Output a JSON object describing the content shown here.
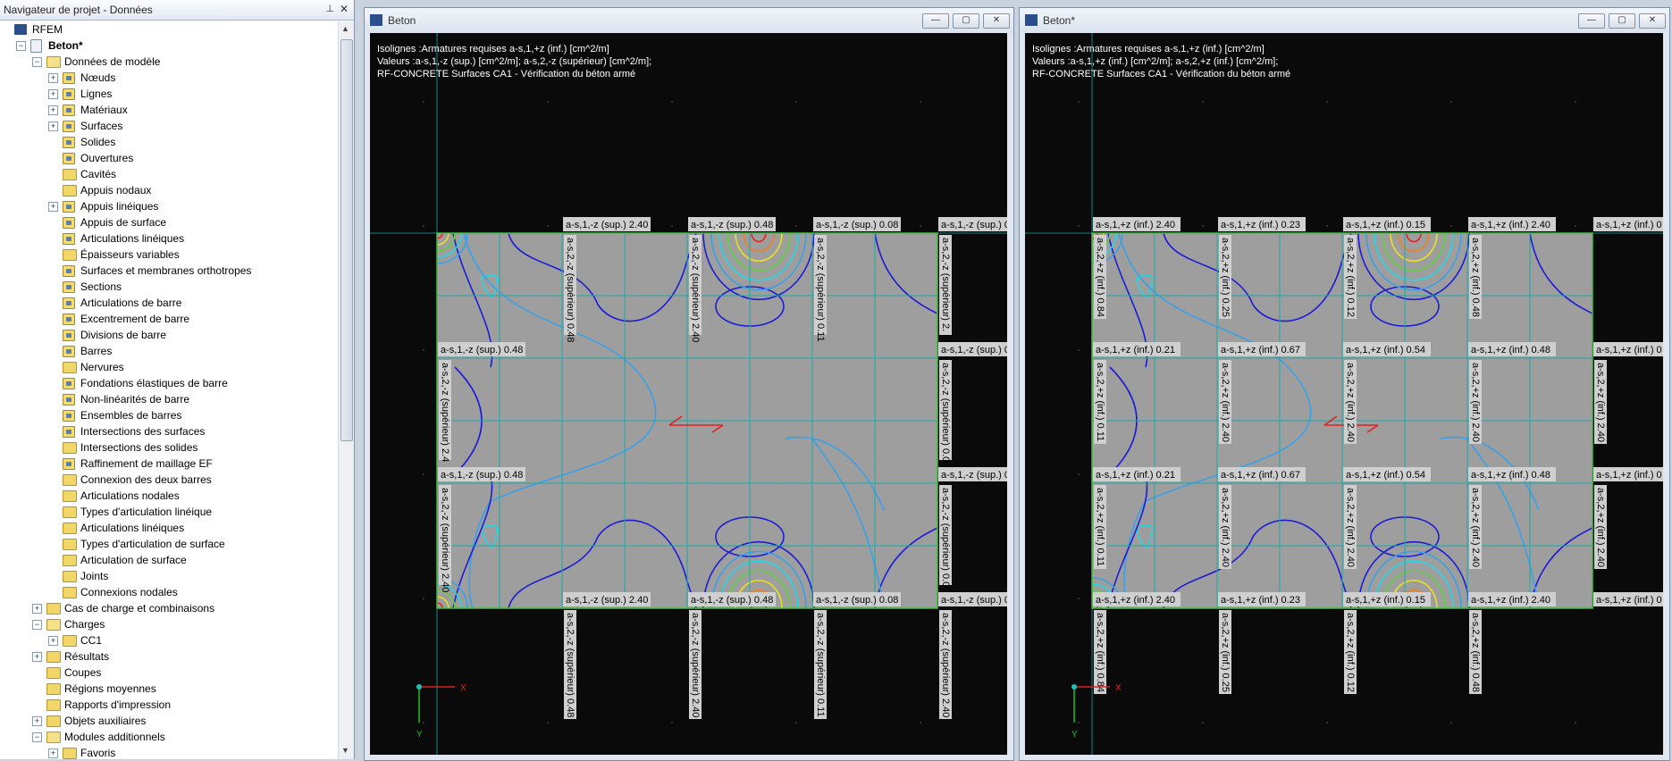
{
  "navigator": {
    "title": "Navigateur de projet - Données",
    "tree": [
      {
        "label": "RFEM",
        "level": 0,
        "exp": "",
        "icon": "app",
        "bold": false,
        "name": "tree-item-rfem"
      },
      {
        "label": "Beton*",
        "level": 1,
        "exp": "-",
        "icon": "doc",
        "bold": true,
        "name": "tree-item-beton"
      },
      {
        "label": "Données de modèle",
        "level": 2,
        "exp": "-",
        "icon": "folder open",
        "bold": false,
        "name": "tree-item-donnees-modele"
      },
      {
        "label": "Nœuds",
        "level": 3,
        "exp": "+",
        "icon": "item",
        "bold": false,
        "name": "tree-item-noeuds"
      },
      {
        "label": "Lignes",
        "level": 3,
        "exp": "+",
        "icon": "item",
        "bold": false,
        "name": "tree-item-lignes"
      },
      {
        "label": "Matériaux",
        "level": 3,
        "exp": "+",
        "icon": "item",
        "bold": false,
        "name": "tree-item-materiaux"
      },
      {
        "label": "Surfaces",
        "level": 3,
        "exp": "+",
        "icon": "item",
        "bold": false,
        "name": "tree-item-surfaces"
      },
      {
        "label": "Solides",
        "level": 3,
        "exp": "",
        "icon": "item",
        "bold": false,
        "name": "tree-item-solides"
      },
      {
        "label": "Ouvertures",
        "level": 3,
        "exp": "",
        "icon": "item",
        "bold": false,
        "name": "tree-item-ouvertures"
      },
      {
        "label": "Cavités",
        "level": 3,
        "exp": "",
        "icon": "folder",
        "bold": false,
        "name": "tree-item-cavites"
      },
      {
        "label": "Appuis nodaux",
        "level": 3,
        "exp": "",
        "icon": "folder",
        "bold": false,
        "name": "tree-item-appuis-nodaux"
      },
      {
        "label": "Appuis linéiques",
        "level": 3,
        "exp": "+",
        "icon": "item",
        "bold": false,
        "name": "tree-item-appuis-lineiques"
      },
      {
        "label": "Appuis de surface",
        "level": 3,
        "exp": "",
        "icon": "item",
        "bold": false,
        "name": "tree-item-appuis-surface"
      },
      {
        "label": "Articulations linéiques",
        "level": 3,
        "exp": "",
        "icon": "item",
        "bold": false,
        "name": "tree-item-articulations-lineiques"
      },
      {
        "label": "Épaisseurs variables",
        "level": 3,
        "exp": "",
        "icon": "folder",
        "bold": false,
        "name": "tree-item-epaisseurs-variables"
      },
      {
        "label": "Surfaces et membranes orthotropes",
        "level": 3,
        "exp": "",
        "icon": "item",
        "bold": false,
        "name": "tree-item-surfaces-orthotropes"
      },
      {
        "label": "Sections",
        "level": 3,
        "exp": "",
        "icon": "item",
        "bold": false,
        "name": "tree-item-sections"
      },
      {
        "label": "Articulations de barre",
        "level": 3,
        "exp": "",
        "icon": "item",
        "bold": false,
        "name": "tree-item-articulations-barre"
      },
      {
        "label": "Excentrement de barre",
        "level": 3,
        "exp": "",
        "icon": "item",
        "bold": false,
        "name": "tree-item-excentrement-barre"
      },
      {
        "label": "Divisions de barre",
        "level": 3,
        "exp": "",
        "icon": "item",
        "bold": false,
        "name": "tree-item-divisions-barre"
      },
      {
        "label": "Barres",
        "level": 3,
        "exp": "",
        "icon": "item",
        "bold": false,
        "name": "tree-item-barres"
      },
      {
        "label": "Nervures",
        "level": 3,
        "exp": "",
        "icon": "folder",
        "bold": false,
        "name": "tree-item-nervures"
      },
      {
        "label": "Fondations élastiques de barre",
        "level": 3,
        "exp": "",
        "icon": "item",
        "bold": false,
        "name": "tree-item-fondations-elastiques"
      },
      {
        "label": "Non-linéarités de barre",
        "level": 3,
        "exp": "",
        "icon": "item",
        "bold": false,
        "name": "tree-item-non-linearites"
      },
      {
        "label": "Ensembles de barres",
        "level": 3,
        "exp": "",
        "icon": "item",
        "bold": false,
        "name": "tree-item-ensembles-barres"
      },
      {
        "label": "Intersections des surfaces",
        "level": 3,
        "exp": "",
        "icon": "item",
        "bold": false,
        "name": "tree-item-intersections-surfaces"
      },
      {
        "label": "Intersections des solides",
        "level": 3,
        "exp": "",
        "icon": "folder",
        "bold": false,
        "name": "tree-item-intersections-solides"
      },
      {
        "label": "Raffinement de maillage EF",
        "level": 3,
        "exp": "",
        "icon": "item",
        "bold": false,
        "name": "tree-item-raffinement-maillage"
      },
      {
        "label": "Connexion des deux barres",
        "level": 3,
        "exp": "",
        "icon": "folder",
        "bold": false,
        "name": "tree-item-connexion-barres"
      },
      {
        "label": "Articulations nodales",
        "level": 3,
        "exp": "",
        "icon": "folder",
        "bold": false,
        "name": "tree-item-articulations-nodales"
      },
      {
        "label": "Types d'articulation linéique",
        "level": 3,
        "exp": "",
        "icon": "folder",
        "bold": false,
        "name": "tree-item-types-articulation-lineique"
      },
      {
        "label": "Articulations linéiques",
        "level": 3,
        "exp": "",
        "icon": "folder",
        "bold": false,
        "name": "tree-item-articulations-lineiques-2"
      },
      {
        "label": "Types d'articulation de surface",
        "level": 3,
        "exp": "",
        "icon": "folder",
        "bold": false,
        "name": "tree-item-types-articulation-surface"
      },
      {
        "label": "Articulation de surface",
        "level": 3,
        "exp": "",
        "icon": "folder",
        "bold": false,
        "name": "tree-item-articulation-surface"
      },
      {
        "label": "Joints",
        "level": 3,
        "exp": "",
        "icon": "folder",
        "bold": false,
        "name": "tree-item-joints"
      },
      {
        "label": "Connexions nodales",
        "level": 3,
        "exp": "",
        "icon": "folder",
        "bold": false,
        "name": "tree-item-connexions-nodales"
      },
      {
        "label": "Cas de charge et combinaisons",
        "level": 2,
        "exp": "+",
        "icon": "folder",
        "bold": false,
        "name": "tree-item-cas-charge"
      },
      {
        "label": "Charges",
        "level": 2,
        "exp": "-",
        "icon": "folder open",
        "bold": false,
        "name": "tree-item-charges"
      },
      {
        "label": "CC1",
        "level": 3,
        "exp": "+",
        "icon": "folder",
        "bold": false,
        "name": "tree-item-cc1"
      },
      {
        "label": "Résultats",
        "level": 2,
        "exp": "+",
        "icon": "folder",
        "bold": false,
        "name": "tree-item-resultats"
      },
      {
        "label": "Coupes",
        "level": 2,
        "exp": "",
        "icon": "folder",
        "bold": false,
        "name": "tree-item-coupes"
      },
      {
        "label": "Régions moyennes",
        "level": 2,
        "exp": "",
        "icon": "folder",
        "bold": false,
        "name": "tree-item-regions-moyennes"
      },
      {
        "label": "Rapports d'impression",
        "level": 2,
        "exp": "",
        "icon": "folder",
        "bold": false,
        "name": "tree-item-rapports"
      },
      {
        "label": "Objets auxiliaires",
        "level": 2,
        "exp": "+",
        "icon": "folder",
        "bold": false,
        "name": "tree-item-objets-auxiliaires"
      },
      {
        "label": "Modules additionnels",
        "level": 2,
        "exp": "-",
        "icon": "folder open",
        "bold": false,
        "name": "tree-item-modules-additionnels"
      },
      {
        "label": "Favoris",
        "level": 3,
        "exp": "+",
        "icon": "folder",
        "bold": false,
        "name": "tree-item-favoris"
      }
    ]
  },
  "windows": [
    {
      "title": "Beton",
      "info": [
        "Isolignes :Armatures requises a-s,1,+z (inf.) [cm^2/m]",
        "Valeurs :a-s,1,-z (sup.) [cm^2/m]; a-s,2,-z (supérieur) [cm^2/m];",
        "RF-CONCRETE Surfaces CA1 - Vérification du béton armé"
      ],
      "labels": {
        "top": [
          "a-s,1,-z (sup.)  2.40",
          "a-s,1,-z (sup.)  0.48",
          "a-s,1,-z (sup.)  0.08",
          "a-s,1,-z (sup.)  0",
          "a-s,1,-z (sup.)  0.48",
          "a-s,1,-z (sup.)  0.",
          "a-s,1,-z (sup.)  0.48",
          "a-s,1,-z (sup.)  0.",
          "a-s,1,-z (sup.)  2.40",
          "a-s,1,-z (sup.)  0.48",
          "a-s,1,-z (sup.)  0.08",
          "a-s,1,-z (sup.)  0"
        ],
        "side": [
          "a-s,2,-z (supérieur)  0.48",
          "a-s,2,-z (supérieur)  2.40",
          "a-s,2,-z (supérieur)  0.11",
          "a-s,2,-z (supérieur)  2.",
          "a-s,2,-z (supérieur)  2.4",
          "a-s,2,-z (supérieur)  0.0",
          "a-s,2,-z (supérieur)  2.40",
          "a-s,2,-z (supérieur)  0.0",
          "a-s,2,-z (supérieur)  0.48",
          "a-s,2,-z (supérieur)  2.40",
          "a-s,2,-z (supérieur)  0.11",
          "a-s,2,-z (supérieur)  2.40"
        ]
      }
    },
    {
      "title": "Beton*",
      "info": [
        "Isolignes :Armatures requises a-s,1,+z (inf.) [cm^2/m]",
        "Valeurs :a-s,1,+z (inf.) [cm^2/m]; a-s,2,+z (inf.) [cm^2/m];",
        "RF-CONCRETE Surfaces CA1 - Vérification du béton armé"
      ],
      "labels": {
        "top": [
          "a-s,1,+z (inf.)  2.40",
          "a-s,1,+z (inf.)  0.23",
          "a-s,1,+z (inf.)  0.15",
          "a-s,1,+z (inf.)  2.40",
          "a-s,1,+z (inf.)  0",
          "a-s,1,+z (inf.)  0.21",
          "a-s,1,+z (inf.)  0.67",
          "a-s,1,+z (inf.)  0.54",
          "a-s,1,+z (inf.)  0.48",
          "a-s,1,+z (inf.)  0",
          "a-s,1,+z (inf.)  0.21",
          "a-s,1,+z (inf.)  0.67",
          "a-s,1,+z (inf.)  0.54",
          "a-s,1,+z (inf.)  0.48",
          "a-s,1,+z (inf.)  0",
          "a-s,1,+z (inf.)  2.40",
          "a-s,1,+z (inf.)  0.23",
          "a-s,1,+z (inf.)  0.15",
          "a-s,1,+z (inf.)  2.40",
          "a-s,1,+z (inf.)  0"
        ],
        "side": [
          "a-s,2,+z (inf.)  0.84",
          "a-s,2,+z (inf.)  0.25",
          "a-s,2,+z (inf.)  0.12",
          "a-s,2,+z (inf.)  0.48",
          "a-s,2,+z (inf.)  0.11",
          "a-s,2,+z (inf.)  2.40",
          "a-s,2,+z (inf.)  2.40",
          "a-s,2,+z (inf.)  2.40",
          "a-s,2,+z (inf.)  2.40",
          "a-s,2,+z (inf.)  0.11",
          "a-s,2,+z (inf.)  2.40",
          "a-s,2,+z (inf.)  2.40",
          "a-s,2,+z (inf.)  2.40",
          "a-s,2,+z (inf.)  2.40",
          "a-s,2,+z (inf.)  0.84",
          "a-s,2,+z (inf.)  0.25",
          "a-s,2,+z (inf.)  0.12",
          "a-s,2,+z (inf.)  0.48"
        ]
      }
    }
  ],
  "axes": {
    "x": "X",
    "y": "Y"
  },
  "colors": {
    "background": "#0a0a0a",
    "plate": "#9e9e9e",
    "grid": "#1aa8a8",
    "contour_dark": "#1c1cd6",
    "contour_light": "#3aa0e8",
    "contour_cyan": "#20d8e8",
    "contour_hot": "#e8e020"
  }
}
